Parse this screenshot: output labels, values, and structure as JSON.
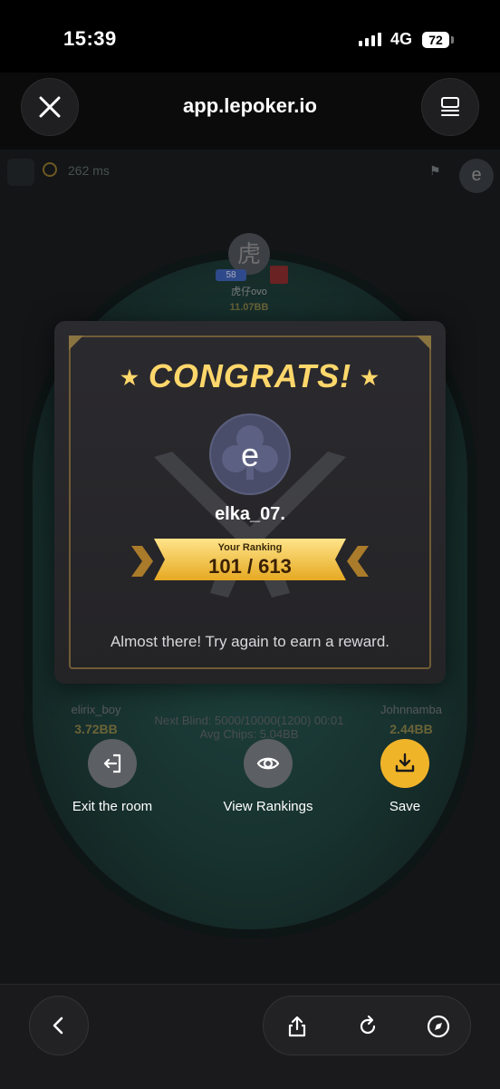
{
  "status": {
    "time": "15:39",
    "network": "4G",
    "battery": "72"
  },
  "browser": {
    "url": "app.lepoker.io"
  },
  "game": {
    "latency": "262 ms",
    "top_avatar": "e",
    "seat_top": {
      "avatar": "虎",
      "level": "58",
      "name": "虎仔ovo",
      "chips": "11.07BB"
    },
    "seat_left": {
      "name": "elirix_boy",
      "chips": "3.72BB"
    },
    "seat_right": {
      "name": "Johnnamba",
      "chips": "2.44BB"
    },
    "next_blind": "Next Blind: 5000/10000(1200) 00:01",
    "avg_chips": "Avg Chips: 5.04BB"
  },
  "modal": {
    "title": "CONGRATS!",
    "player_avatar": "e",
    "player_name": "elka_07.",
    "rank_label": "Your Ranking",
    "rank_value": "101 / 613",
    "message": "Almost there! Try again to earn a reward."
  },
  "actions": {
    "exit": "Exit the room",
    "rankings": "View Rankings",
    "save": "Save"
  },
  "colors": {
    "gold": "#ffd76b",
    "save": "#f0b429",
    "modal_bg": "#2b2a2e"
  }
}
